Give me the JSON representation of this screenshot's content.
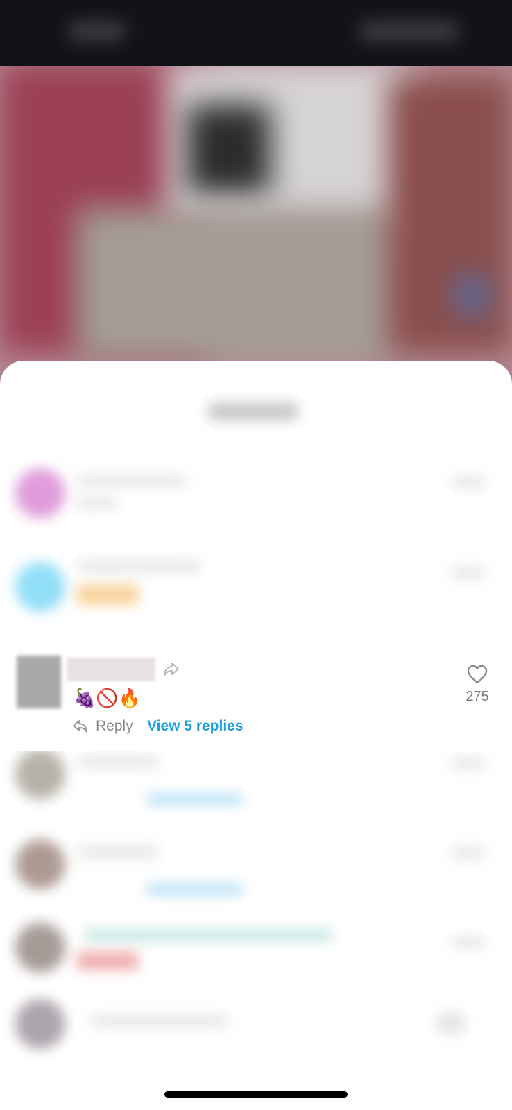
{
  "focused_comment": {
    "text": "🍇🚫🔥",
    "likes": "275",
    "reply_label": "Reply",
    "view_replies_label": "View 5 replies"
  },
  "icons": {
    "share": "share-arrow-icon",
    "like": "heart-outline-icon",
    "reply": "reply-arrow-icon"
  },
  "colors": {
    "link_blue": "#1d9fe0",
    "count_gray": "#7a7a7a",
    "top_bar": "#121318"
  }
}
